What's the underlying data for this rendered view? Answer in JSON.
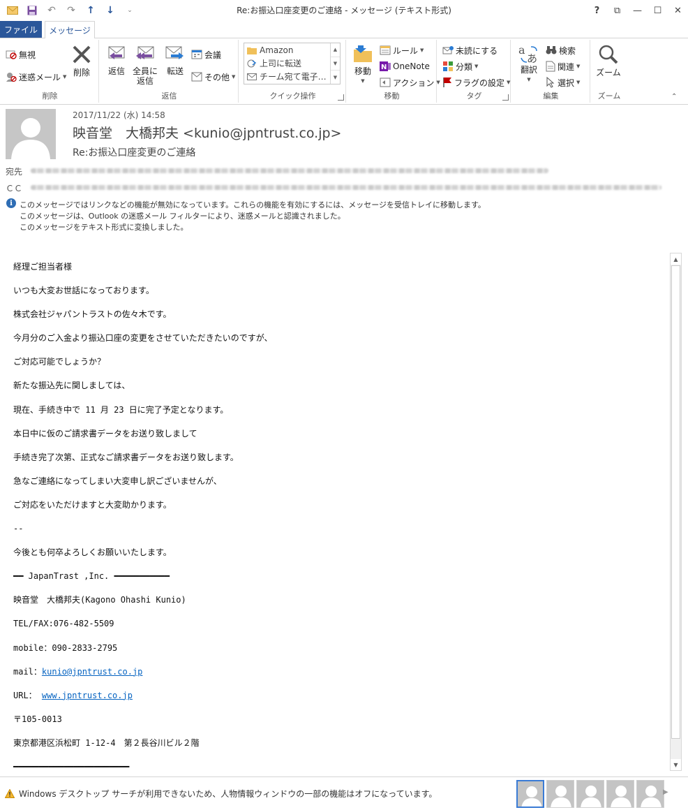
{
  "window": {
    "title": "Re:お振込口座変更のご連絡 - メッセージ (テキスト形式)",
    "buttons": {
      "help": "?",
      "ribbon_display": "⧉",
      "minimize": "—",
      "maximize": "☐",
      "close": "✕"
    }
  },
  "tabs": {
    "file": "ファイル",
    "message": "メッセージ"
  },
  "ribbon": {
    "delete_group": {
      "label": "削除",
      "ignore": "無視",
      "junk": "迷惑メール",
      "delete": "削除"
    },
    "respond_group": {
      "label": "返信",
      "reply": "返信",
      "reply_all_1": "全員に",
      "reply_all_2": "返信",
      "forward": "転送",
      "meeting": "会議",
      "more": "その他"
    },
    "quick_steps": {
      "label": "クイック操作",
      "items": [
        "Amazon",
        "上司に転送",
        "チーム宛て電子…"
      ]
    },
    "move_group": {
      "label": "移動",
      "move": "移動",
      "rules": "ルール",
      "onenote": "OneNote",
      "actions": "アクション"
    },
    "tags_group": {
      "label": "タグ",
      "unread": "未読にする",
      "categorize": "分類",
      "followup": "フラグの設定"
    },
    "edit_group": {
      "label": "編集",
      "translate": "翻訳",
      "find": "検索",
      "related": "関連",
      "select": "選択"
    },
    "zoom_group": {
      "label": "ズーム",
      "zoom": "ズーム"
    }
  },
  "header": {
    "date": "2017/11/22 (水) 14:58",
    "from": "映音堂　大橋邦夫 <kunio@jpntrust.co.jp>",
    "subject": "Re:お振込口座変更のご連絡",
    "to_label": "宛先",
    "cc_label": "ＣＣ",
    "info": [
      "このメッセージではリンクなどの機能が無効になっています。これらの機能を有効にするには、メッセージを受信トレイに移動します。",
      "このメッセージは、Outlook の迷惑メール フィルターにより、迷惑メールと認識されました。",
      "このメッセージをテキスト形式に変換しました。"
    ]
  },
  "body": {
    "lines": [
      "経理ご担当者様",
      "いつも大変お世話になっております。",
      "株式会社ジャパントラストの佐々木です。",
      "今月分のご入金より振込口座の変更をさせていただきたいのですが、",
      "ご対応可能でしょうか？",
      "新たな振込先に関しましては、",
      "現在、手続き中で 11 月 23 日に完了予定となります。",
      "本日中に仮のご請求書データをお送り致しまして",
      "手続き完了次第、正式なご請求書データをお送り致します。",
      "急なご連絡になってしまい大変申し訳ございませんが、",
      "ご対応をいただけますと大変助かります。",
      "--",
      "今後とも何卒よろしくお願いいたします。",
      "━━ JapanTrast ,Inc. ━━━━━━━━━━━",
      "映音堂　大橋邦夫(Kagono Ohashi Kunio)",
      "TEL/FAX:076-482-5509",
      "mobile：090-2833-2795"
    ],
    "mail_label": "mail：",
    "mail_link": "kunio@jpntrust.co.jp",
    "url_label": "URL： ",
    "url_link": "www.jpntrust.co.jp",
    "postal": "〒105-0013",
    "address": "東京都港区浜松町 1-12-4　第２長谷川ビル２階",
    "rule": "━━━━━━━━━━━━━━━━━━━━━━━"
  },
  "status": {
    "warning": "Windows デスクトップ サーチが利用できないため、人物情報ウィンドウの一部の機能はオフになっています。"
  },
  "colors": {
    "accent": "#2b579a",
    "link": "#0563c1",
    "flag": "#c00000"
  }
}
